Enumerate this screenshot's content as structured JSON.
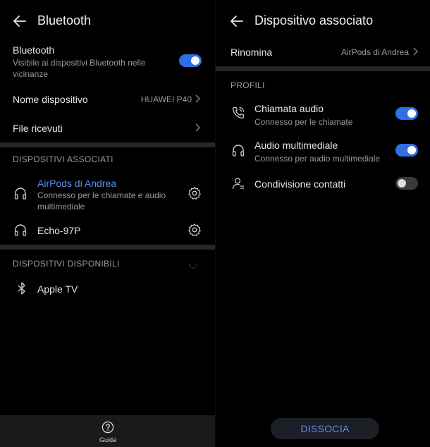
{
  "left": {
    "title": "Bluetooth",
    "bluetooth_row": {
      "label": "Bluetooth",
      "sub": "Visibile ai dispositivi Bluetooth nelle vicinanze",
      "toggle_on": true
    },
    "device_name_row": {
      "label": "Nome dispositivo",
      "value": "HUAWEI P40"
    },
    "received_files_row": {
      "label": "File ricevuti"
    },
    "paired_section": "DISPOSITIVI ASSOCIATI",
    "paired": [
      {
        "name": "AirPods di Andrea",
        "sub": "Connesso per le chiamate e audio multimediale",
        "icon": "headphones-icon",
        "active": true
      },
      {
        "name": "Echo-97P",
        "sub": "",
        "icon": "headphones-icon",
        "active": false
      }
    ],
    "available_section": "DISPOSITIVI DISPONIBILI",
    "available": [
      {
        "name": "Apple TV",
        "icon": "bluetooth-icon"
      }
    ],
    "bottom": {
      "help_label": "Guida"
    }
  },
  "right": {
    "title": "Dispositivo associato",
    "rename_row": {
      "label": "Rinomina",
      "value": "AirPods di Andrea"
    },
    "profiles_section": "PROFILI",
    "profiles": [
      {
        "label": "Chiamata audio",
        "sub": "Connesso per le chiamate",
        "icon": "phone-icon",
        "on": true
      },
      {
        "label": "Audio multimediale",
        "sub": "Connesso per audio multimediale",
        "icon": "headphones-icon",
        "on": true
      },
      {
        "label": "Condivisione contatti",
        "sub": "",
        "icon": "contact-icon",
        "on": false
      }
    ],
    "dissocia_label": "DISSOCIA"
  },
  "colors": {
    "accent": "#5b8def",
    "toggle_on": "#2f6fe3",
    "background": "#000000",
    "divider": "#262626"
  }
}
